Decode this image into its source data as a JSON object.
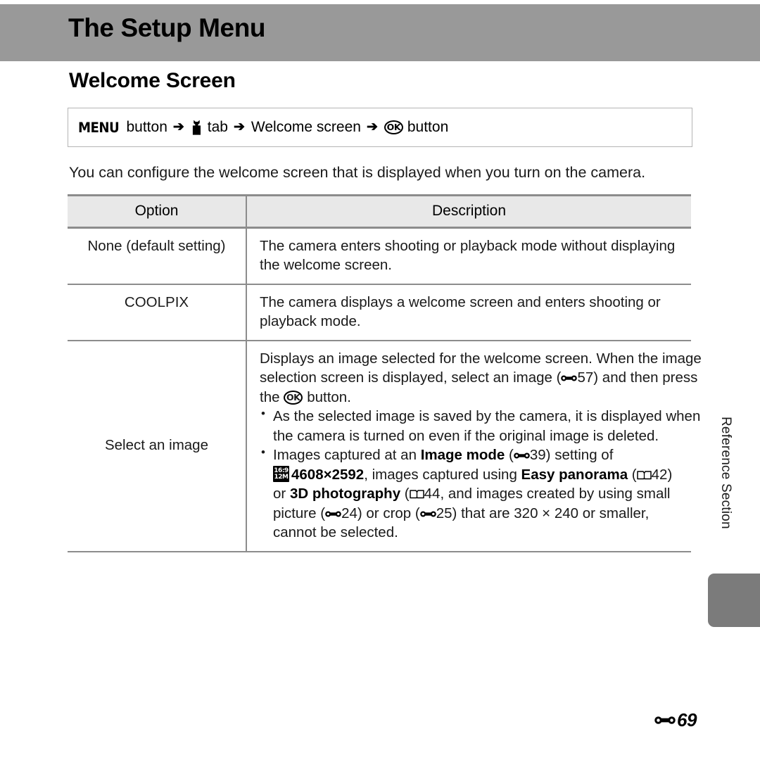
{
  "page": {
    "chapter_title": "The Setup Menu",
    "section_title": "Welcome Screen",
    "footer_page": "69",
    "footer_icon": "reference-section-icon",
    "side_tab_label": "Reference Section",
    "band_color": "#999999",
    "side_tab_color": "#7b7b7b",
    "table_header_bg": "#e8e8e8",
    "rule_color": "#8c8c8c"
  },
  "nav_path": {
    "menu_label": "MENU",
    "button_word_1": "button",
    "arrow": "➔",
    "wrench_icon": "wrench-icon",
    "tab_word": "tab",
    "middle_label": "Welcome screen",
    "ok_icon_label": "OK",
    "button_word_2": "button"
  },
  "intro": "You can configure the welcome screen that is displayed when you turn on the camera.",
  "table": {
    "headers": [
      "Option",
      "Description"
    ],
    "rows": [
      {
        "option": "None (default setting)",
        "description_lines": [
          "The camera enters shooting or playback mode without displaying",
          "the welcome screen."
        ]
      },
      {
        "option": "COOLPIX",
        "description_lines": [
          "The camera displays a welcome screen and enters shooting or",
          "playback mode."
        ]
      },
      {
        "option": "Select an image",
        "intro_lines": {
          "l1": "Displays an image selected for the welcome screen. When the image",
          "l2a": "selection screen is displayed, select an image (",
          "l2_ref": "57",
          "l2b": ") and then press",
          "l3a": "the",
          "l3b": "button."
        },
        "bullets": [
          {
            "lines": [
              "As the selected image is saved by the camera, it is displayed when",
              "the camera is turned on even if the original image is deleted."
            ]
          },
          {
            "segments": {
              "b1_a": "Images captured at an",
              "b1_bold": "Image mode",
              "b1_ref": "39",
              "b1_b": ") setting of",
              "b2_icon_top": "16:9",
              "b2_icon_bottom": "12M",
              "b2_bold": "4608×2592",
              "b2_a": ", images captured using",
              "b2_bold2": "Easy panorama",
              "b2_pageref": "42",
              "b3_a": "or",
              "b3_bold": "3D photography",
              "b3_pageref": "44",
              "b3_b": ", and images created by using small",
              "b4_a": "picture (",
              "b4_ref1": "24",
              "b4_b": ") or crop (",
              "b4_ref2": "25",
              "b4_c": ") that are 320 × 240 or smaller,",
              "b5": "cannot be selected."
            }
          }
        ]
      }
    ]
  }
}
